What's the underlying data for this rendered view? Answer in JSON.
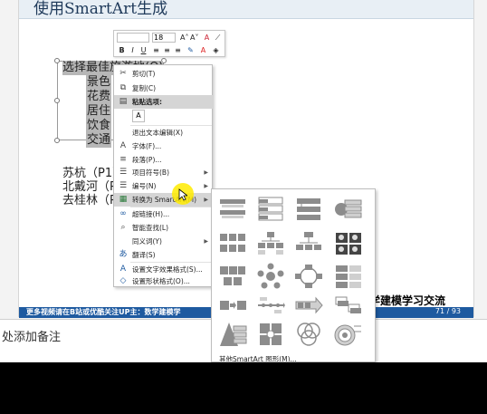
{
  "slide": {
    "title": "使用SmartArt生成",
    "selected_line": "选择最佳旅游地(Q)",
    "items": [
      "景色",
      "花费",
      "居住",
      "饮食",
      "交通"
    ],
    "body_lines": [
      "苏杭（P1）",
      "北戴河（P",
      "去桂林（P"
    ],
    "footer_text": "更多视频请在B站或优酷关注UP主：数学建模学",
    "page_number": "71 / 93",
    "brand_text": "数学建模学习交流"
  },
  "notes": {
    "placeholder": "处添加备注"
  },
  "mini_toolbar": {
    "font_value": "",
    "size_value": "18",
    "grow_font": "A˄",
    "shrink_font": "A˅",
    "clear_format": "A",
    "bold": "B",
    "italic": "I",
    "underline": "U",
    "font_color": "A"
  },
  "context_menu": {
    "items": [
      {
        "label": "剪切(T)",
        "icon": "scissors-icon",
        "glyph": "✂"
      },
      {
        "label": "复制(C)",
        "icon": "copy-icon",
        "glyph": "⧉"
      },
      {
        "label": "粘贴选项:",
        "icon": "paste-icon",
        "glyph": "📋"
      },
      {
        "label": "退出文本编辑(X)",
        "icon": "",
        "glyph": ""
      },
      {
        "label": "字体(F)...",
        "icon": "font-icon",
        "glyph": "A"
      },
      {
        "label": "段落(P)...",
        "icon": "paragraph-icon",
        "glyph": "≡"
      },
      {
        "label": "项目符号(B)",
        "icon": "bullets-icon",
        "glyph": "☰"
      },
      {
        "label": "编号(N)",
        "icon": "numbering-icon",
        "glyph": "☰"
      },
      {
        "label": "转换为 SmartArt(M)",
        "icon": "smartart-icon",
        "glyph": "▦"
      },
      {
        "label": "超链接(H)...",
        "icon": "hyperlink-icon",
        "glyph": "🔗"
      },
      {
        "label": "智能查找(L)",
        "icon": "smart-lookup-icon",
        "glyph": "⌕"
      },
      {
        "label": "同义词(Y)",
        "icon": "",
        "glyph": ""
      },
      {
        "label": "翻译(S)",
        "icon": "translate-icon",
        "glyph": "あ"
      },
      {
        "label": "设置文字效果格式(S)...",
        "icon": "text-effects-icon",
        "glyph": "A"
      },
      {
        "label": "设置形状格式(O)...",
        "icon": "shape-format-icon",
        "glyph": "◇"
      }
    ]
  },
  "gallery": {
    "more_label": "其他SmartArt 图形(M)..."
  },
  "colors": {
    "footer_bar": "#1e5aa0",
    "menu_highlight": "#d5d5d5",
    "selection": "#b7b7b7"
  }
}
